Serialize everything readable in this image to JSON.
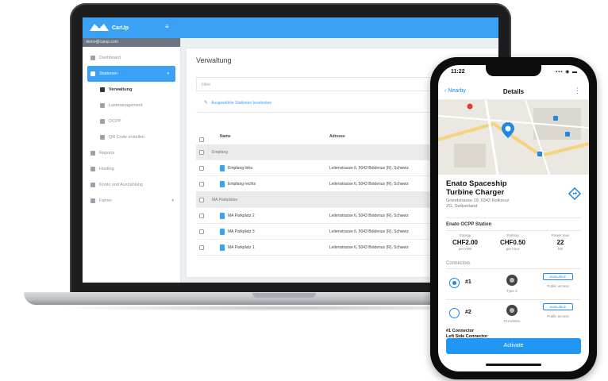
{
  "web_app": {
    "brand": "CarUp",
    "user": "demo@carup.com",
    "sidebar": {
      "items": [
        {
          "label": "Dashboard",
          "icon": "gauge-icon"
        },
        {
          "label": "Stationen",
          "icon": "station-icon",
          "active": true
        },
        {
          "label": "Verwaltung",
          "icon": "list-icon",
          "sub": true,
          "current": true
        },
        {
          "label": "Lastmanagement",
          "icon": "bolt-icon",
          "sub": true
        },
        {
          "label": "OCPP",
          "icon": "plug-icon",
          "sub": true
        },
        {
          "label": "QR Code erstellen",
          "icon": "qr-icon",
          "sub": true
        },
        {
          "label": "Reports",
          "icon": "report-icon"
        },
        {
          "label": "Hosting",
          "icon": "tool-icon"
        },
        {
          "label": "Konto und Auszahlung",
          "icon": "money-icon"
        },
        {
          "label": "Fahrer",
          "icon": "car-icon"
        }
      ]
    },
    "main": {
      "title": "Verwaltung",
      "filter_placeholder": "Filter",
      "edit_link": "Ausgewählte Stationen bearbeiten",
      "columns": [
        "Name",
        "Adresse"
      ],
      "rows": [
        {
          "type": "group",
          "name": "Empfang"
        },
        {
          "type": "item",
          "name": "Empfang links",
          "address": "Leitenstrasse 6, 5043 Boldenus (R), Schweiz"
        },
        {
          "type": "item",
          "name": "Empfang rechts",
          "address": "Leitenstrasse 6, 5043 Boldenus (R), Schweiz"
        },
        {
          "type": "group",
          "name": "MA Parkplätze"
        },
        {
          "type": "item",
          "name": "MA Parkplatz 2",
          "address": "Leitenstrasse 6, 5043 Boldenus (R), Schweiz"
        },
        {
          "type": "item",
          "name": "MA Parkplatz 3",
          "address": "Leitenstrasse 6, 5043 Boldenus (R), Schweiz"
        },
        {
          "type": "item",
          "name": "MA Parkplatz 1",
          "address": "Leitenstrasse 6, 5043 Boldenus (R), Schweiz"
        }
      ]
    }
  },
  "phone_app": {
    "status_time": "11:22",
    "status_icons": "▪▪▪ ◉ ▬",
    "back_label": "Nearby",
    "title": "Details",
    "station_name_line1": "Enato Spaceship",
    "station_name_line2": "Turbine Charger",
    "address_line1": "Grundstrasse 19, 6343 Rotkreuz",
    "address_line2": "ZG, Switzerland",
    "station_type": "Enato OCPP Station",
    "prices": [
      {
        "label": "Energy",
        "value": "CHF2.00",
        "unit": "per kWh"
      },
      {
        "label": "Parking",
        "value": "CHF0.50",
        "unit": "per hour"
      },
      {
        "label": "Power max",
        "value": "22",
        "unit": "kW"
      }
    ],
    "connectors_title": "Connectors",
    "connectors": [
      {
        "num": "#1",
        "type": "Type 2",
        "status": "AVAILABLE",
        "access": "Public access",
        "selected": true
      },
      {
        "num": "#2",
        "type": "CHAdeMo",
        "status": "AVAILABLE",
        "access": "Public access",
        "selected": false
      }
    ],
    "footer_line1": "#1 Connector",
    "footer_line2": "Left Side Connector",
    "activate_label": "Activate",
    "accent": "#2196f3"
  }
}
